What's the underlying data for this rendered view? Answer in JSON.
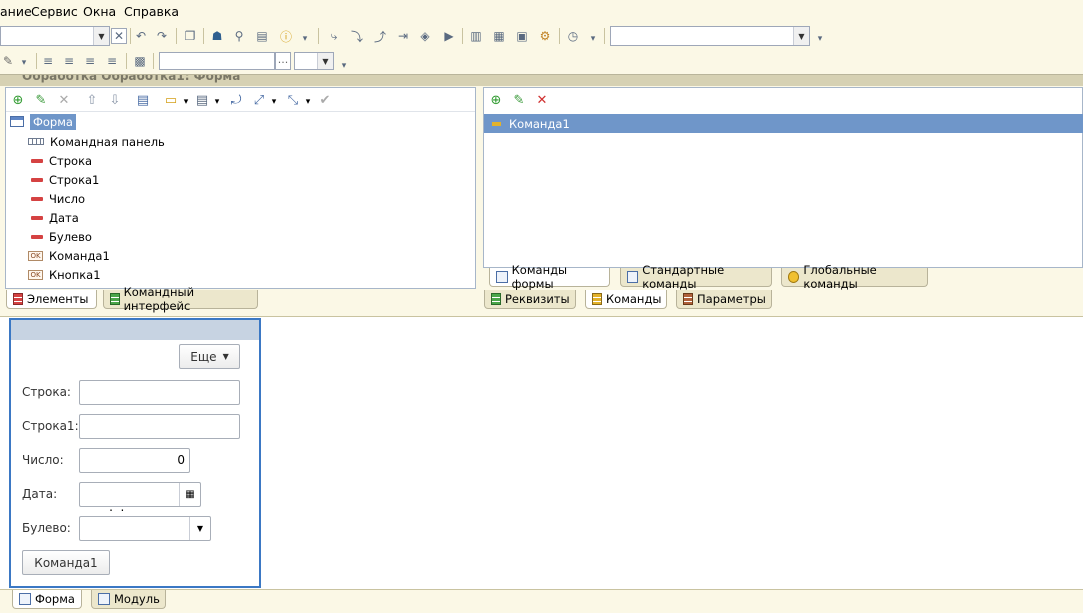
{
  "menu": {
    "items": [
      "ание",
      "Сервис",
      "Окна",
      "Справка"
    ]
  },
  "toolbar": {
    "search_value": "",
    "style_combo": "",
    "font_combo": "",
    "ellipsis": "..."
  },
  "doc_title": "Обработка Обработка1: Форма",
  "elements_panel": {
    "root": "Форма",
    "items": [
      {
        "label": "Командная панель",
        "icon": "command-panel-icon"
      },
      {
        "label": "Строка",
        "icon": "field-icon"
      },
      {
        "label": "Строка1",
        "icon": "field-icon"
      },
      {
        "label": "Число",
        "icon": "field-icon"
      },
      {
        "label": "Дата",
        "icon": "field-icon"
      },
      {
        "label": "Булево",
        "icon": "field-icon"
      },
      {
        "label": "Команда1",
        "icon": "ok-button-icon"
      },
      {
        "label": "Кнопка1",
        "icon": "ok-button-icon"
      }
    ],
    "tabs": [
      "Элементы",
      "Командный интерфейс"
    ]
  },
  "commands_panel": {
    "items": [
      "Команда1"
    ],
    "inner_tabs": [
      "Команды формы",
      "Стандартные команды",
      "Глобальные команды"
    ],
    "outer_tabs": [
      "Реквизиты",
      "Команды",
      "Параметры"
    ]
  },
  "form_preview": {
    "more_button": "Еще",
    "fields": {
      "stroka": {
        "label": "Строка:",
        "value": ""
      },
      "stroka1": {
        "label": "Строка1:",
        "value": ""
      },
      "chislo": {
        "label": "Число:",
        "value": "0"
      },
      "data": {
        "label": "Дата:",
        "value": " .  ."
      },
      "bulevo": {
        "label": "Булево:",
        "value": ""
      }
    },
    "command_button": "Команда1"
  },
  "bottom_tabs": [
    "Форма",
    "Модуль"
  ],
  "colors": {
    "accent": "#3b78c4",
    "selection": "#6f96c9",
    "chrome": "#fbf8e6"
  }
}
